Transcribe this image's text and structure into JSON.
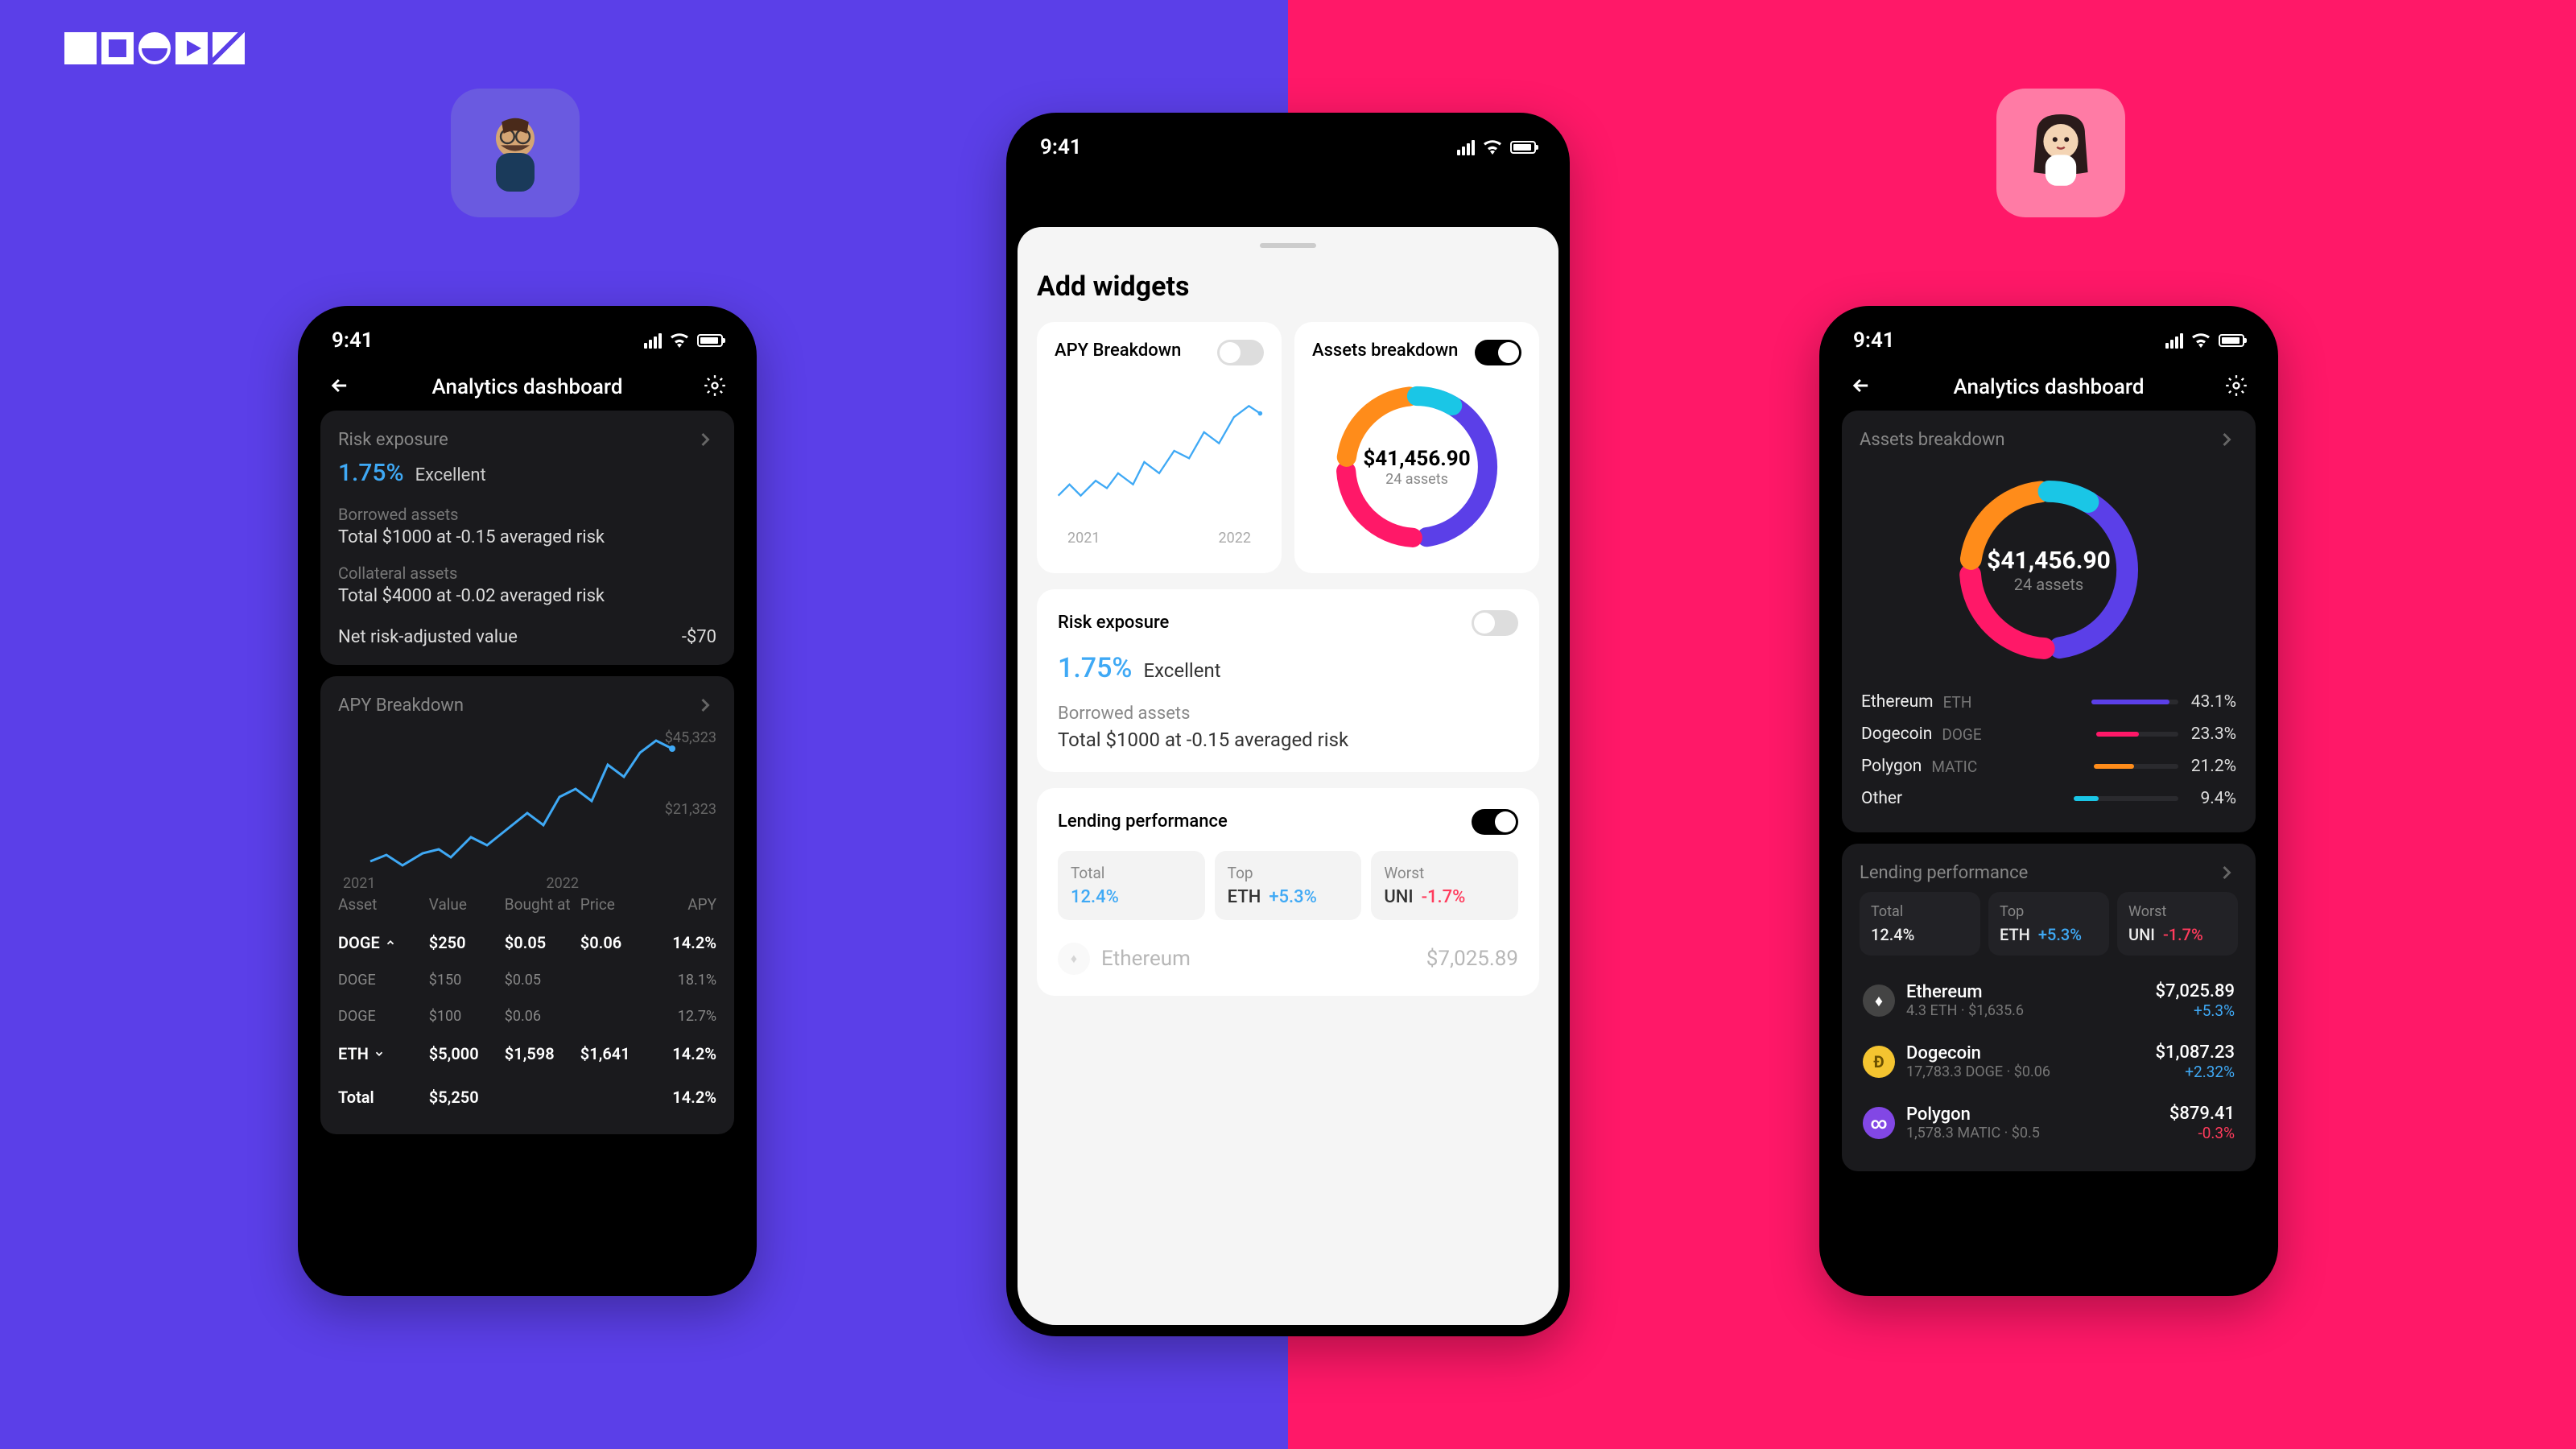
{
  "brand": "NOONE",
  "statusbar": {
    "time": "9:41"
  },
  "phone_left": {
    "title": "Analytics dashboard",
    "risk": {
      "title": "Risk exposure",
      "percent": "1.75%",
      "rating": "Excellent",
      "borrowed_label": "Borrowed assets",
      "borrowed_text": "Total $1000 at -0.15 averaged risk",
      "collateral_label": "Collateral assets",
      "collateral_text": "Total $4000 at -0.02 averaged risk",
      "net_label": "Net risk-adjusted value",
      "net_value": "-$70"
    },
    "apy": {
      "title": "APY Breakdown",
      "val_top": "$45,323",
      "val_mid": "$21,323",
      "x_start": "2021",
      "x_end": "2022",
      "headers": {
        "asset": "Asset",
        "value": "Value",
        "bought": "Bought at",
        "price": "Price",
        "apy": "APY"
      },
      "rows": [
        {
          "asset": "DOGE",
          "expand": "up",
          "value": "$250",
          "bought": "$0.05",
          "price": "$0.06",
          "apy": "14.2%",
          "main": true
        },
        {
          "asset": "DOGE",
          "value": "$150",
          "bought": "$0.05",
          "price": "",
          "apy": "18.1%",
          "main": false
        },
        {
          "asset": "DOGE",
          "value": "$100",
          "bought": "$0.06",
          "price": "",
          "apy": "12.7%",
          "main": false
        },
        {
          "asset": "ETH",
          "expand": "down",
          "value": "$5,000",
          "bought": "$1,598",
          "price": "$1,641",
          "apy": "14.2%",
          "main": true
        }
      ],
      "total": {
        "label": "Total",
        "value": "$5,250",
        "apy": "14.2%"
      }
    }
  },
  "phone_center": {
    "sheet_title": "Add widgets",
    "widgets": {
      "apy": {
        "label": "APY Breakdown",
        "on": false,
        "x_start": "2021",
        "x_end": "2022"
      },
      "assets": {
        "label": "Assets breakdown",
        "on": true,
        "donut_value": "$41,456.90",
        "donut_sub": "24 assets"
      }
    },
    "risk": {
      "label": "Risk exposure",
      "on": false,
      "percent": "1.75%",
      "rating": "Excellent",
      "borrowed_label": "Borrowed assets",
      "borrowed_text": "Total $1000 at -0.15 averaged risk"
    },
    "lending": {
      "label": "Lending performance",
      "on": true,
      "stats": {
        "total": {
          "label": "Total",
          "value": "12.4%"
        },
        "top": {
          "label": "Top",
          "sym": "ETH",
          "value": "+5.3%"
        },
        "worst": {
          "label": "Worst",
          "sym": "UNI",
          "value": "-1.7%"
        }
      },
      "faded": {
        "name": "Ethereum",
        "amount": "$7,025.89"
      }
    }
  },
  "phone_right": {
    "title": "Analytics dashboard",
    "assets": {
      "title": "Assets breakdown",
      "donut_value": "$41,456.90",
      "donut_sub": "24 assets",
      "legend": [
        {
          "name": "Ethereum",
          "sym": "ETH",
          "pct": "43.1%",
          "width": 90,
          "color": "#5B3FE8"
        },
        {
          "name": "Dogecoin",
          "sym": "DOGE",
          "pct": "23.3%",
          "width": 52,
          "color": "#FF1868"
        },
        {
          "name": "Polygon",
          "sym": "MATIC",
          "pct": "21.2%",
          "width": 48,
          "color": "#FF8C1A"
        },
        {
          "name": "Other",
          "sym": "",
          "pct": "9.4%",
          "width": 24,
          "color": "#1AC6E6"
        }
      ]
    },
    "lending": {
      "title": "Lending performance",
      "stats": {
        "total": {
          "label": "Total",
          "value": "12.4%"
        },
        "top": {
          "label": "Top",
          "sym": "ETH",
          "value": "+5.3%"
        },
        "worst": {
          "label": "Worst",
          "sym": "UNI",
          "value": "-1.7%"
        }
      },
      "coins": [
        {
          "name": "Ethereum",
          "sub": "4.3 ETH · $1,635.6",
          "amount": "$7,025.89",
          "change": "+5.3%",
          "pos": true,
          "icon": "eth"
        },
        {
          "name": "Dogecoin",
          "sub": "17,783.3 DOGE · $0.06",
          "amount": "$1,087.23",
          "change": "+2.32%",
          "pos": true,
          "icon": "doge"
        },
        {
          "name": "Polygon",
          "sub": "1,578.3 MATIC · $0.5",
          "amount": "$879.41",
          "change": "-0.3%",
          "pos": false,
          "icon": "matic"
        }
      ]
    }
  },
  "chart_data": {
    "type": "line",
    "title": "APY Breakdown",
    "x": [
      "2021",
      "2022"
    ],
    "ylim": [
      0,
      45323
    ],
    "note": "Portfolio APY trend with upward trajectory; endpoint ≈ $45,323; midpoint ≈ $21,323"
  }
}
